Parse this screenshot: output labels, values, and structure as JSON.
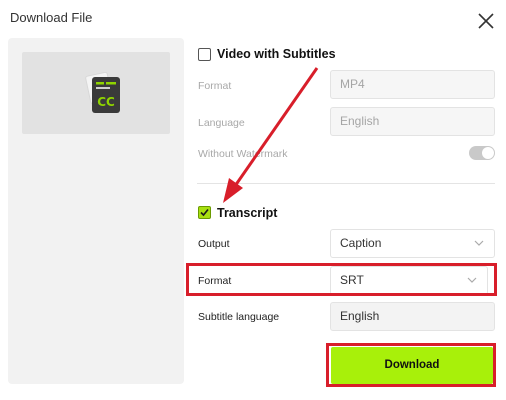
{
  "dialog": {
    "title": "Download File"
  },
  "video_section": {
    "label": "Video with Subtitles",
    "checked": false,
    "format_label": "Format",
    "format_value": "MP4",
    "language_label": "Language",
    "language_value": "English",
    "watermark_label": "Without Watermark"
  },
  "transcript_section": {
    "label": "Transcript",
    "checked": true,
    "output_label": "Output",
    "output_value": "Caption",
    "format_label": "Format",
    "format_value": "SRT",
    "subtitle_language_label": "Subtitle language",
    "subtitle_language_value": "English"
  },
  "actions": {
    "download_label": "Download"
  },
  "colors": {
    "accent": "#a8f00a",
    "highlight": "#d81e2a"
  },
  "icons": [
    "close-icon",
    "closed-captions-icon",
    "chevron-down-icon",
    "checkbox-icon",
    "annotation-arrow"
  ]
}
